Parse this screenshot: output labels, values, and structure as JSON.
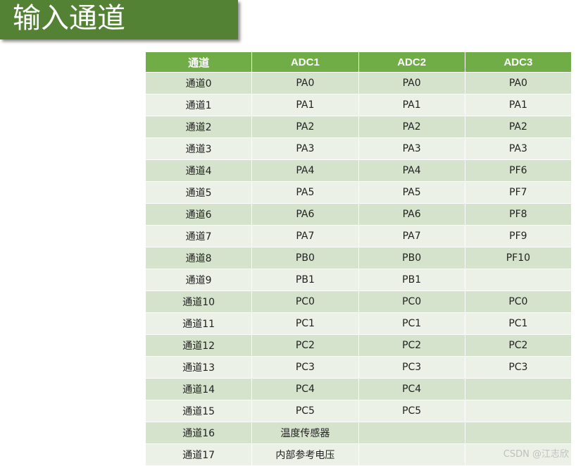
{
  "title": "输入通道",
  "table": {
    "headers": [
      "通道",
      "ADC1",
      "ADC2",
      "ADC3"
    ],
    "rows": [
      [
        "通道0",
        "PA0",
        "PA0",
        "PA0"
      ],
      [
        "通道1",
        "PA1",
        "PA1",
        "PA1"
      ],
      [
        "通道2",
        "PA2",
        "PA2",
        "PA2"
      ],
      [
        "通道3",
        "PA3",
        "PA3",
        "PA3"
      ],
      [
        "通道4",
        "PA4",
        "PA4",
        "PF6"
      ],
      [
        "通道5",
        "PA5",
        "PA5",
        "PF7"
      ],
      [
        "通道6",
        "PA6",
        "PA6",
        "PF8"
      ],
      [
        "通道7",
        "PA7",
        "PA7",
        "PF9"
      ],
      [
        "通道8",
        "PB0",
        "PB0",
        "PF10"
      ],
      [
        "通道9",
        "PB1",
        "PB1",
        ""
      ],
      [
        "通道10",
        "PC0",
        "PC0",
        "PC0"
      ],
      [
        "通道11",
        "PC1",
        "PC1",
        "PC1"
      ],
      [
        "通道12",
        "PC2",
        "PC2",
        "PC2"
      ],
      [
        "通道13",
        "PC3",
        "PC3",
        "PC3"
      ],
      [
        "通道14",
        "PC4",
        "PC4",
        ""
      ],
      [
        "通道15",
        "PC5",
        "PC5",
        ""
      ],
      [
        "通道16",
        "温度传感器",
        "",
        ""
      ],
      [
        "通道17",
        "内部参考电压",
        "",
        ""
      ]
    ]
  },
  "watermark": "CSDN @江志欣",
  "colors": {
    "banner": "#548235",
    "header": "#70ad47",
    "row_dark": "#d6e3cc",
    "row_light": "#ebf1e6"
  }
}
